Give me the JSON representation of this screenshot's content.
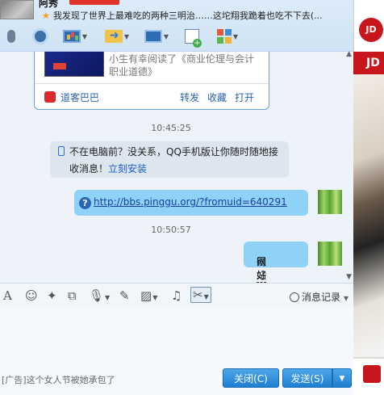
{
  "header": {
    "nickname": "阿秀",
    "signature": "我发现了世界上最难吃的两种三明治……这坨翔我跪着也吃不下去(..."
  },
  "toolbar": {
    "items": [
      {
        "name": "voice-call"
      },
      {
        "name": "video-call"
      },
      {
        "name": "screen-share"
      },
      {
        "name": "send-file"
      },
      {
        "name": "remote-assist"
      },
      {
        "name": "create-discussion"
      },
      {
        "name": "more-apps"
      }
    ]
  },
  "chat": {
    "share_card": {
      "description": "小生有幸阅读了《商业伦理与会计职业道德》",
      "brand": "道客巴巴",
      "forward": "转发",
      "favorite": "收藏",
      "open": "打开"
    },
    "time1": "10:45:25",
    "system_msg": {
      "line1": "不在电脑前？没关系，QQ手机版让你随时随地接",
      "line2_prefix": "收消息！",
      "install_link": "立刻安装"
    },
    "msg1": {
      "url": "http://bbs.pinggu.org/?fromuid=640291"
    },
    "time2": "10:50:57",
    "msg2": {
      "text_a": "很好的",
      "text_b": "网站"
    }
  },
  "input_toolbar": {
    "history_label": "消息记录"
  },
  "bottom": {
    "ad_text": "[广告]这个女人节被她承包了",
    "close_label": "关闭(C)",
    "send_label": "发送(S)"
  },
  "side_ad": {
    "brand_top": "JD",
    "brand_banner": "JD"
  },
  "colors": {
    "bubble": "#8ed2f8",
    "primary_button": "#1f7fd0",
    "link": "#2a62b0",
    "jd_red": "#c8161d"
  }
}
